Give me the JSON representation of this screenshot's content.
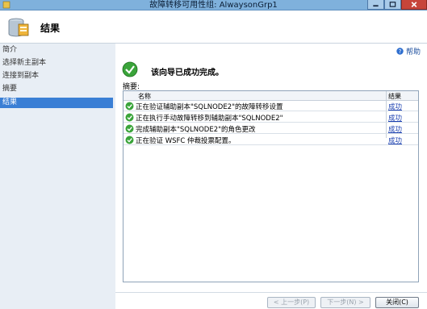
{
  "window": {
    "title": "故障转移可用性组: AlwaysonGrp1",
    "colors": {
      "titlebar": "#7fb1dc",
      "close_button": "#c7453a",
      "selected": "#3a7fd5",
      "link": "#1a3fb0"
    }
  },
  "header": {
    "title": "结果"
  },
  "sidebar": {
    "items": [
      {
        "label": "简介",
        "selected": false
      },
      {
        "label": "选择新主副本",
        "selected": false
      },
      {
        "label": "连接到副本",
        "selected": false
      },
      {
        "label": "摘要",
        "selected": false
      },
      {
        "label": "结果",
        "selected": true
      }
    ]
  },
  "main": {
    "help_label": "帮助",
    "success_message": "该向导已成功完成。",
    "summary_label": "摘要:",
    "table": {
      "columns": [
        "名称",
        "结果"
      ],
      "rows": [
        {
          "name": "正在验证辅助副本\"SQLNODE2\"的故障转移设置",
          "result": "成功"
        },
        {
          "name": "正在执行手动故障转移到辅助副本\"SQLNODE2\"",
          "result": "成功"
        },
        {
          "name": "完成辅助副本\"SQLNODE2\"的角色更改",
          "result": "成功"
        },
        {
          "name": "正在验证 WSFC 仲裁投票配置。",
          "result": "成功"
        }
      ]
    }
  },
  "footer": {
    "back_label": "< 上一步(P)",
    "next_label": "下一步(N) >",
    "close_label": "关闭(C)"
  }
}
